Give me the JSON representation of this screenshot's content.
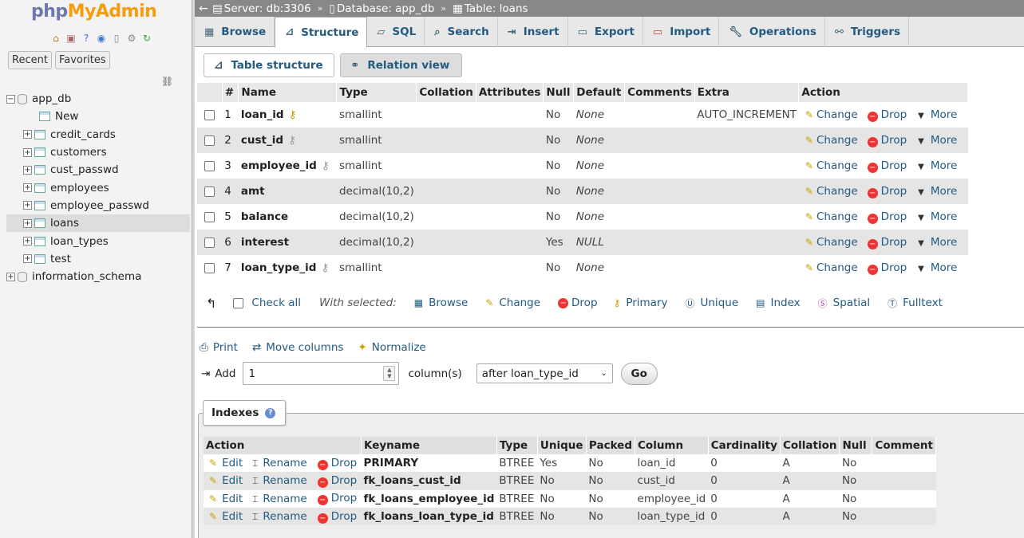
{
  "nav": {
    "logo_php": "php",
    "logo_myadmin": "MyAdmin",
    "recent": "Recent",
    "favorites": "Favorites",
    "tree": [
      {
        "label": "app_db",
        "level": 1,
        "type": "db",
        "expand": "−"
      },
      {
        "label": "New",
        "level": 3,
        "type": "new"
      },
      {
        "label": "credit_cards",
        "level": 2,
        "type": "table",
        "expand": "+"
      },
      {
        "label": "customers",
        "level": 2,
        "type": "table",
        "expand": "+"
      },
      {
        "label": "cust_passwd",
        "level": 2,
        "type": "table",
        "expand": "+"
      },
      {
        "label": "employees",
        "level": 2,
        "type": "table",
        "expand": "+"
      },
      {
        "label": "employee_passwd",
        "level": 2,
        "type": "table",
        "expand": "+"
      },
      {
        "label": "loans",
        "level": 2,
        "type": "table",
        "expand": "+",
        "selected": true
      },
      {
        "label": "loan_types",
        "level": 2,
        "type": "table",
        "expand": "+"
      },
      {
        "label": "test",
        "level": 2,
        "type": "table",
        "expand": "+"
      },
      {
        "label": "information_schema",
        "level": 1,
        "type": "db",
        "expand": "+"
      }
    ]
  },
  "topbar": {
    "server": "Server: db:3306",
    "database": "Database: app_db",
    "table": "Table: loans"
  },
  "tabs": [
    "Browse",
    "Structure",
    "SQL",
    "Search",
    "Insert",
    "Export",
    "Import",
    "Operations",
    "Triggers"
  ],
  "subtabs": {
    "table_structure": "Table structure",
    "relation_view": "Relation view"
  },
  "structure": {
    "headers": [
      "#",
      "Name",
      "Type",
      "Collation",
      "Attributes",
      "Null",
      "Default",
      "Comments",
      "Extra",
      "Action"
    ],
    "rows": [
      {
        "num": "1",
        "name": "loan_id",
        "key": "primary",
        "type": "smallint",
        "null": "No",
        "default": "None",
        "extra": "AUTO_INCREMENT"
      },
      {
        "num": "2",
        "name": "cust_id",
        "key": "foreign",
        "type": "smallint",
        "null": "No",
        "default": "None",
        "extra": ""
      },
      {
        "num": "3",
        "name": "employee_id",
        "key": "foreign",
        "type": "smallint",
        "null": "No",
        "default": "None",
        "extra": ""
      },
      {
        "num": "4",
        "name": "amt",
        "key": "",
        "type": "decimal(10,2)",
        "null": "No",
        "default": "None",
        "extra": ""
      },
      {
        "num": "5",
        "name": "balance",
        "key": "",
        "type": "decimal(10,2)",
        "null": "No",
        "default": "None",
        "extra": ""
      },
      {
        "num": "6",
        "name": "interest",
        "key": "",
        "type": "decimal(10,2)",
        "null": "Yes",
        "default": "NULL",
        "extra": ""
      },
      {
        "num": "7",
        "name": "loan_type_id",
        "key": "foreign",
        "type": "smallint",
        "null": "No",
        "default": "None",
        "extra": ""
      }
    ],
    "actions": {
      "change": "Change",
      "drop": "Drop",
      "more": "More"
    }
  },
  "checkall": {
    "check_all": "Check all",
    "with_selected": "With selected:",
    "browse": "Browse",
    "change": "Change",
    "drop": "Drop",
    "primary": "Primary",
    "unique": "Unique",
    "index": "Index",
    "spatial": "Spatial",
    "fulltext": "Fulltext"
  },
  "tools": {
    "print": "Print",
    "move_columns": "Move columns",
    "normalize": "Normalize"
  },
  "add": {
    "label": "Add",
    "value": "1",
    "columns_label": "column(s)",
    "position": "after loan_type_id",
    "go": "Go"
  },
  "indexes": {
    "legend": "Indexes",
    "headers": [
      "Action",
      "Keyname",
      "Type",
      "Unique",
      "Packed",
      "Column",
      "Cardinality",
      "Collation",
      "Null",
      "Comment"
    ],
    "actions": {
      "edit": "Edit",
      "rename": "Rename",
      "drop": "Drop"
    },
    "rows": [
      {
        "keyname": "PRIMARY",
        "type": "BTREE",
        "unique": "Yes",
        "packed": "No",
        "column": "loan_id",
        "cardinality": "0",
        "collation": "A",
        "null": "No",
        "comment": ""
      },
      {
        "keyname": "fk_loans_cust_id",
        "type": "BTREE",
        "unique": "No",
        "packed": "No",
        "column": "cust_id",
        "cardinality": "0",
        "collation": "A",
        "null": "No",
        "comment": ""
      },
      {
        "keyname": "fk_loans_employee_id",
        "type": "BTREE",
        "unique": "No",
        "packed": "No",
        "column": "employee_id",
        "cardinality": "0",
        "collation": "A",
        "null": "No",
        "comment": ""
      },
      {
        "keyname": "fk_loans_loan_type_id",
        "type": "BTREE",
        "unique": "No",
        "packed": "No",
        "column": "loan_type_id",
        "cardinality": "0",
        "collation": "A",
        "null": "No",
        "comment": ""
      }
    ]
  },
  "colors": {
    "link": "#235a81",
    "logo_blue": "#6c78af",
    "logo_orange": "#f89c0e",
    "topbar": "#888888"
  }
}
